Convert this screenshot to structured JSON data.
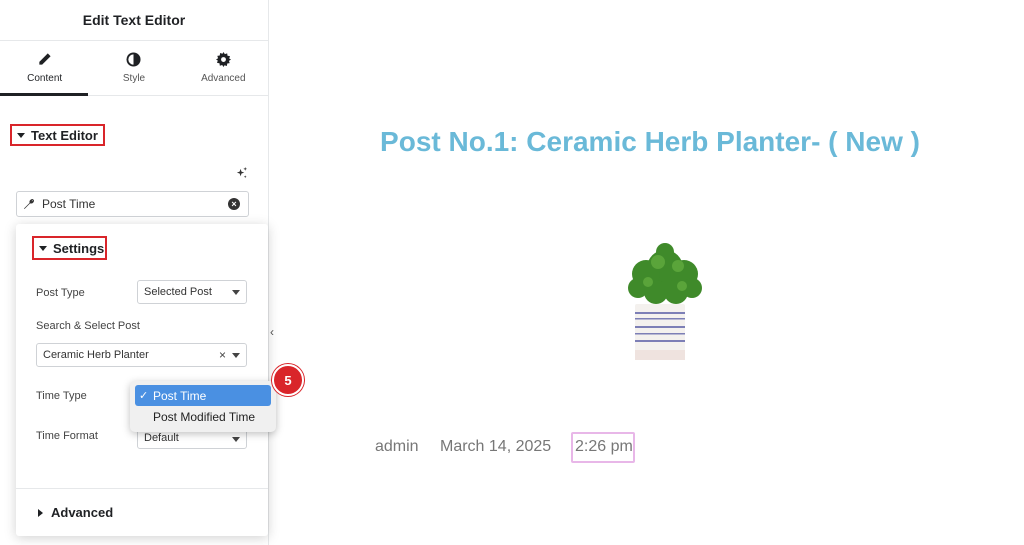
{
  "panel": {
    "title": "Edit Text Editor",
    "tabs": [
      {
        "label": "Content",
        "icon": "pencil-icon",
        "active": true
      },
      {
        "label": "Style",
        "icon": "contrast-icon",
        "active": false
      },
      {
        "label": "Advanced",
        "icon": "gear-icon",
        "active": false
      }
    ],
    "section_label": "Text Editor",
    "dynamic_field_value": "Post Time",
    "settings": {
      "label": "Settings",
      "post_type_label": "Post Type",
      "post_type_value": "Selected Post",
      "search_label": "Search & Select Post",
      "search_value": "Ceramic Herb Planter",
      "time_type_label": "Time Type",
      "time_format_label": "Time Format",
      "time_format_value": "Default",
      "advanced_label": "Advanced"
    },
    "time_type_options": [
      {
        "label": "Post Time",
        "selected": true
      },
      {
        "label": "Post Modified Time",
        "selected": false
      }
    ],
    "step_number": "5"
  },
  "preview": {
    "post_title": "Post No.1: Ceramic Herb Planter- ( New )",
    "author": "admin",
    "date": "March 14, 2025",
    "time": "2:26 pm"
  },
  "colors": {
    "accent_red": "#d9252a",
    "title_blue": "#6ab9d8",
    "selected_blue": "#4a90e2",
    "time_highlight": "#e8b7e8"
  }
}
